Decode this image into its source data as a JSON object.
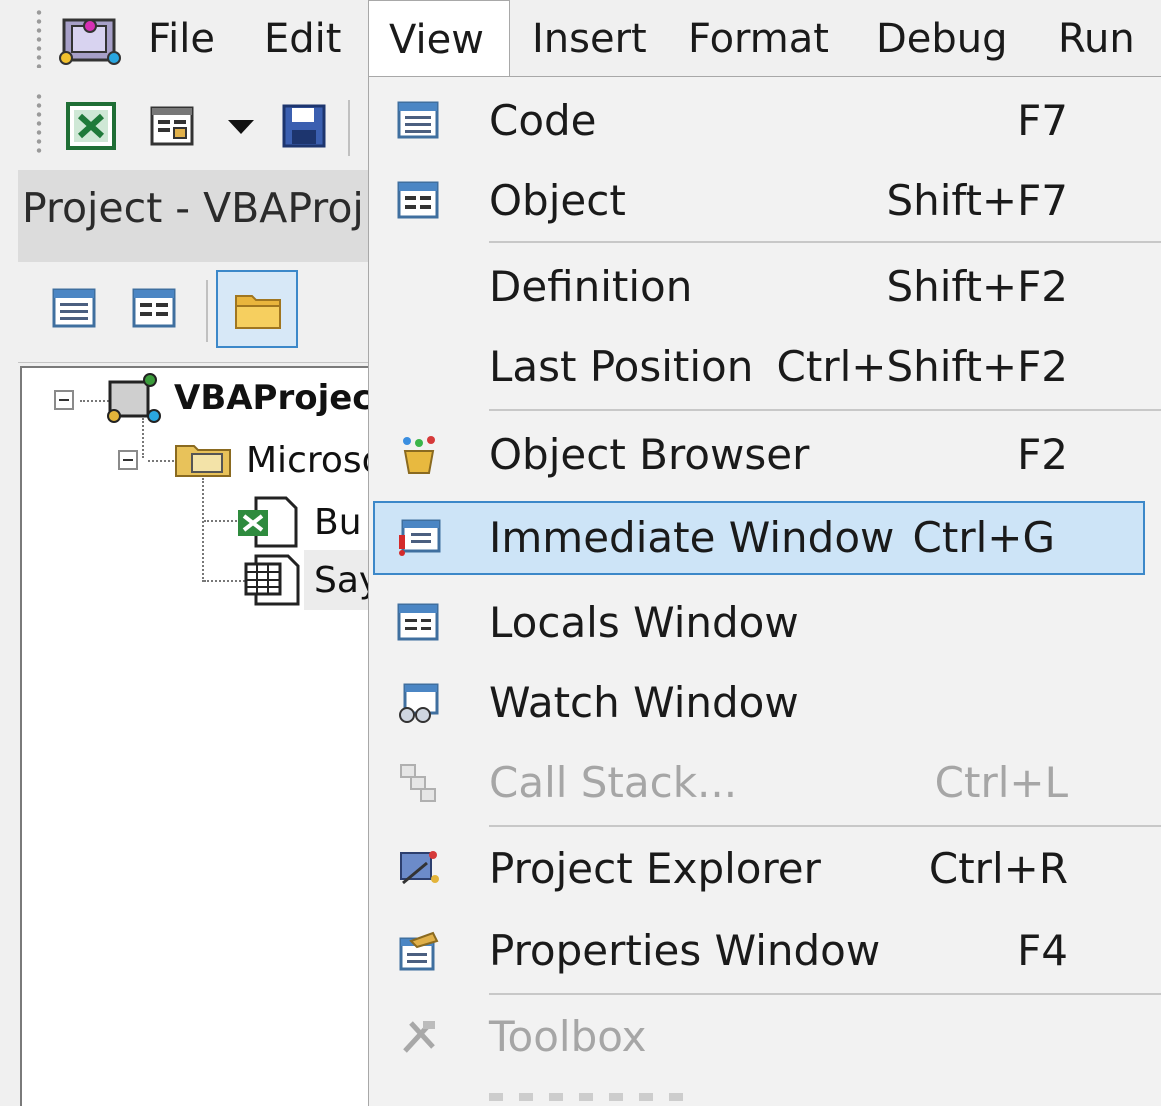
{
  "menubar": {
    "file": "File",
    "edit": "Edit",
    "view": "View",
    "insert": "Insert",
    "format": "Format",
    "debug": "Debug",
    "run": "Run"
  },
  "project": {
    "title": "Project - VBAProj",
    "tree": {
      "root": "VBAProjec",
      "folder": "Microso",
      "item1": "Bu",
      "item2": "Say"
    }
  },
  "view_menu": {
    "items": [
      {
        "label": "Code",
        "shortcut": "F7"
      },
      {
        "label": "Object",
        "shortcut": "Shift+F7"
      },
      {
        "label": "Definition",
        "shortcut": "Shift+F2"
      },
      {
        "label": "Last Position",
        "shortcut": "Ctrl+Shift+F2"
      },
      {
        "label": "Object Browser",
        "shortcut": "F2"
      },
      {
        "label": "Immediate Window",
        "shortcut": "Ctrl+G"
      },
      {
        "label": "Locals Window",
        "shortcut": ""
      },
      {
        "label": "Watch Window",
        "shortcut": ""
      },
      {
        "label": "Call Stack...",
        "shortcut": "Ctrl+L"
      },
      {
        "label": "Project Explorer",
        "shortcut": "Ctrl+R"
      },
      {
        "label": "Properties Window",
        "shortcut": "F4"
      },
      {
        "label": "Toolbox",
        "shortcut": ""
      }
    ],
    "highlighted_item": "Immediate Window",
    "disabled_items": [
      "Call Stack...",
      "Toolbox"
    ]
  },
  "colors": {
    "highlight_bg": "#cde4f7",
    "highlight_border": "#3c88c9",
    "disabled_text": "#a6a6a6"
  }
}
